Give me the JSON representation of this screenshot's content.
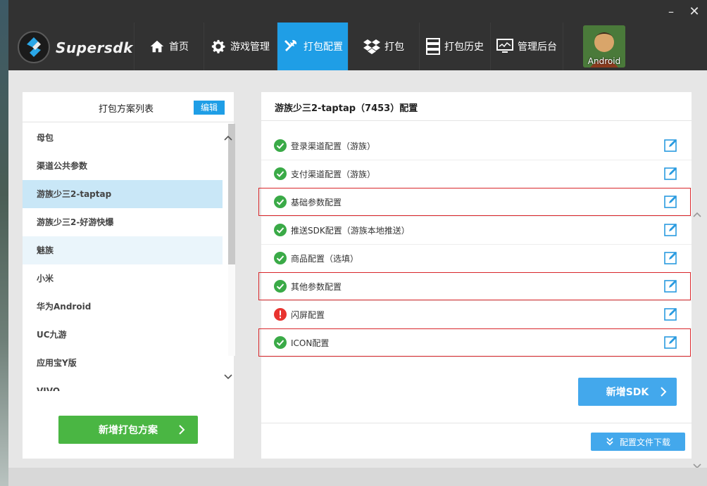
{
  "window": {
    "minimize_glyph": "–",
    "close_glyph": "✕"
  },
  "brand": {
    "name": "Supersdk",
    "accent": "#1f9ee6"
  },
  "nav": {
    "items": [
      {
        "label": "首页",
        "icon": "home-icon"
      },
      {
        "label": "游戏管理",
        "icon": "gear-icon"
      },
      {
        "label": "打包配置",
        "icon": "tools-icon",
        "active": true
      },
      {
        "label": "打包",
        "icon": "dropbox-icon"
      },
      {
        "label": "打包历史",
        "icon": "server-icon"
      },
      {
        "label": "管理后台",
        "icon": "monitor-icon"
      }
    ],
    "platform_label": "Android"
  },
  "plan_list": {
    "title": "打包方案列表",
    "edit_label": "编辑",
    "items": [
      {
        "label": "母包"
      },
      {
        "label": "渠道公共参数"
      },
      {
        "label": "游族少三2-taptap",
        "selected": true
      },
      {
        "label": "游族少三2-好游快爆"
      },
      {
        "label": "魅族",
        "hover": true
      },
      {
        "label": "小米"
      },
      {
        "label": "华为Android"
      },
      {
        "label": "UC九游"
      },
      {
        "label": "应用宝Y版"
      },
      {
        "label": "VIVO"
      }
    ],
    "add_button": "新增打包方案"
  },
  "config": {
    "title": "游族少三2-taptap（7453）配置",
    "rows": [
      {
        "label": "登录渠道配置（游族）",
        "status": "ok",
        "highlighted": false
      },
      {
        "label": "支付渠道配置（游族）",
        "status": "ok",
        "highlighted": false
      },
      {
        "label": "基础参数配置",
        "status": "ok",
        "highlighted": true
      },
      {
        "label": "推送SDK配置（游族本地推送）",
        "status": "ok",
        "highlighted": false
      },
      {
        "label": "商品配置（选填）",
        "status": "ok",
        "highlighted": false
      },
      {
        "label": "其他参数配置",
        "status": "ok",
        "highlighted": true
      },
      {
        "label": "闪屏配置",
        "status": "error",
        "highlighted": false
      },
      {
        "label": "ICON配置",
        "status": "ok",
        "highlighted": true
      }
    ],
    "add_sdk_button": "新增SDK",
    "download_button": "配置文件下载",
    "colors": {
      "ok": "#3aaa47",
      "error": "#e8332f",
      "highlight": "#d9262a"
    }
  }
}
